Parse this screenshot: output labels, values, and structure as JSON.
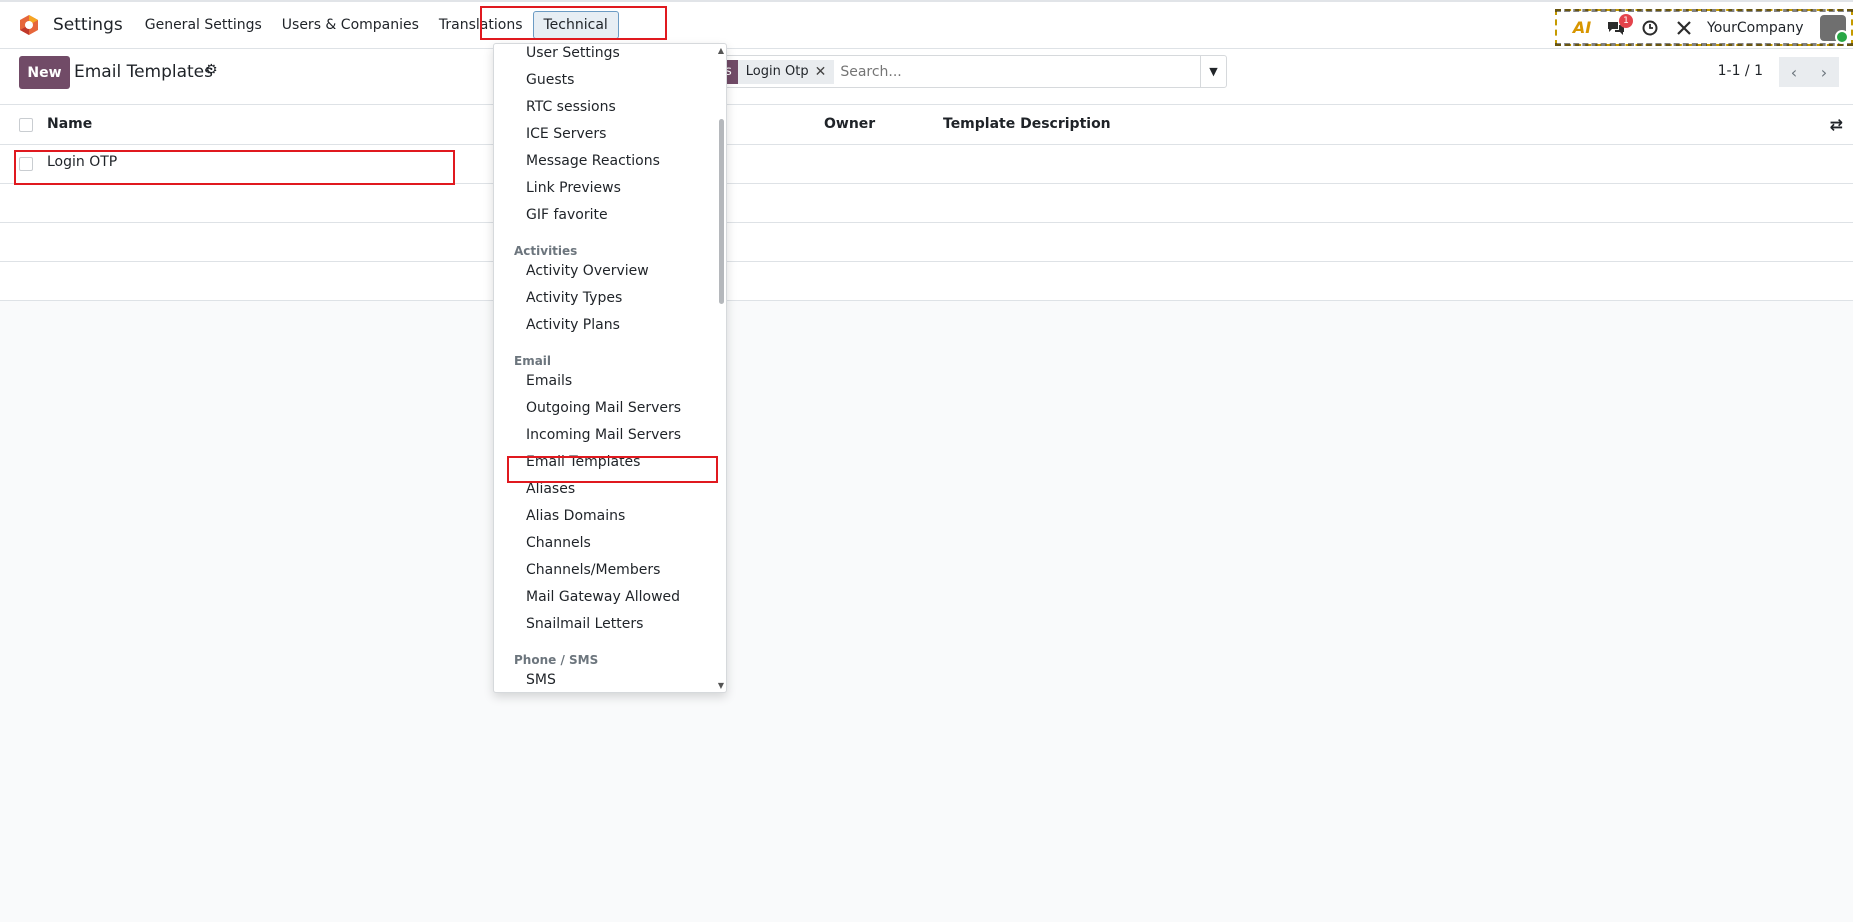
{
  "navbar": {
    "app_title": "Settings",
    "menus": [
      "General Settings",
      "Users & Companies",
      "Translations",
      "Technical"
    ],
    "company": "YourCompany",
    "messages_badge": "1",
    "icons": [
      "ai-icon",
      "chat-icon",
      "clock-icon",
      "tools-icon"
    ]
  },
  "control_panel": {
    "new_label": "New",
    "title": "Email Templates",
    "facet_tag": "s",
    "facet_value": "Login Otp",
    "search_placeholder": "Search...",
    "pager": "1-1 / 1"
  },
  "list": {
    "columns": [
      "Name",
      "Owner",
      "Template Description"
    ],
    "rows": [
      {
        "name": "Login OTP"
      }
    ]
  },
  "dropdown": {
    "items": [
      {
        "type": "item",
        "label": "User Settings"
      },
      {
        "type": "item",
        "label": "Guests"
      },
      {
        "type": "item",
        "label": "RTC sessions"
      },
      {
        "type": "item",
        "label": "ICE Servers"
      },
      {
        "type": "item",
        "label": "Message Reactions"
      },
      {
        "type": "item",
        "label": "Link Previews"
      },
      {
        "type": "item",
        "label": "GIF favorite"
      },
      {
        "type": "section",
        "label": "Activities"
      },
      {
        "type": "item",
        "label": "Activity Overview"
      },
      {
        "type": "item",
        "label": "Activity Types"
      },
      {
        "type": "item",
        "label": "Activity Plans"
      },
      {
        "type": "section",
        "label": "Email"
      },
      {
        "type": "item",
        "label": "Emails"
      },
      {
        "type": "item",
        "label": "Outgoing Mail Servers"
      },
      {
        "type": "item",
        "label": "Incoming Mail Servers"
      },
      {
        "type": "item",
        "label": "Email Templates"
      },
      {
        "type": "item",
        "label": "Aliases"
      },
      {
        "type": "item",
        "label": "Alias Domains"
      },
      {
        "type": "item",
        "label": "Channels"
      },
      {
        "type": "item",
        "label": "Channels/Members"
      },
      {
        "type": "item",
        "label": "Mail Gateway Allowed"
      },
      {
        "type": "item",
        "label": "Snailmail Letters"
      },
      {
        "type": "section",
        "label": "Phone / SMS"
      },
      {
        "type": "item",
        "label": "SMS"
      }
    ]
  },
  "colors": {
    "brand": "#714b67",
    "highlight": "#e0191f"
  }
}
